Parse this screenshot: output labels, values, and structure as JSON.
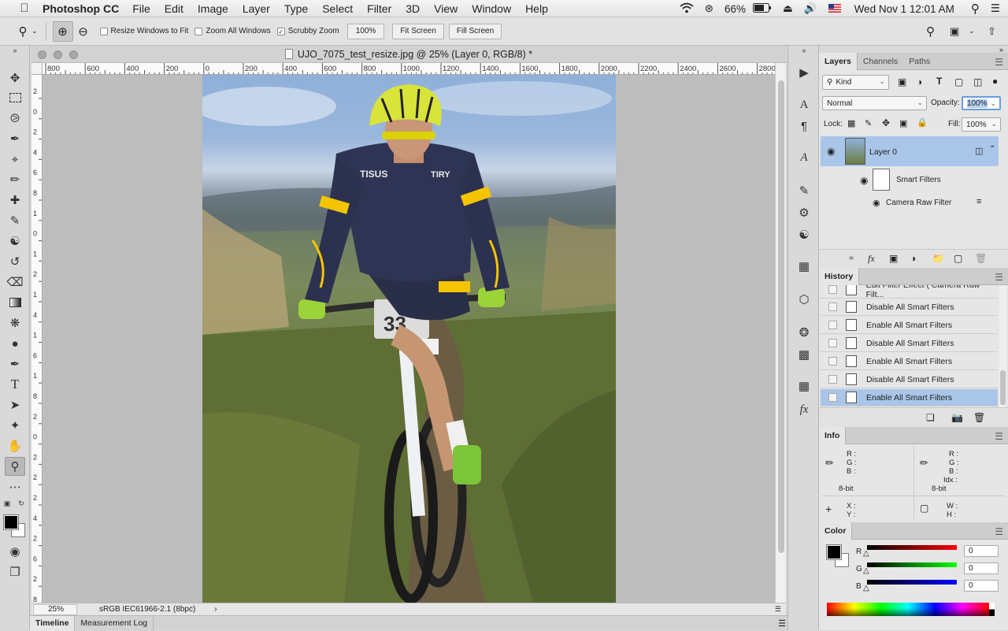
{
  "menubar": {
    "app_name": "Photoshop CC",
    "items": [
      "File",
      "Edit",
      "Image",
      "Layer",
      "Type",
      "Select",
      "Filter",
      "3D",
      "View",
      "Window",
      "Help"
    ],
    "battery": "66%",
    "clock": "Wed Nov 1  12:01 AM"
  },
  "options": {
    "resize_windows": "Resize Windows to Fit",
    "zoom_all": "Zoom All Windows",
    "scrubby": "Scrubby Zoom",
    "zoom_value": "100%",
    "fit_screen": "Fit Screen",
    "fill_screen": "Fill Screen"
  },
  "document": {
    "title": "UJO_7075_test_resize.jpg @ 25% (Layer 0, RGB/8) *",
    "zoom": "25%",
    "profile": "sRGB IEC61966-2.1 (8bpc)",
    "ruler_h": [
      "800",
      "600",
      "400",
      "200",
      "0",
      "200",
      "400",
      "600",
      "800",
      "1000",
      "1200",
      "1400",
      "1600",
      "1800",
      "2000",
      "2200",
      "2400",
      "2600",
      "2800"
    ],
    "ruler_v": [
      "2",
      "0",
      "2",
      "4",
      "6",
      "8",
      "1",
      "0",
      "1",
      "2",
      "1",
      "4",
      "1",
      "6",
      "1",
      "8",
      "2",
      "0",
      "2",
      "2",
      "2",
      "4",
      "2",
      "6",
      "2",
      "8"
    ]
  },
  "bottom_tabs": [
    "Timeline",
    "Measurement Log"
  ],
  "layers_panel": {
    "tabs": [
      "Layers",
      "Channels",
      "Paths"
    ],
    "kind": "Kind",
    "blend_mode": "Normal",
    "opacity_label": "Opacity:",
    "opacity": "100%",
    "lock_label": "Lock:",
    "fill_label": "Fill:",
    "fill": "100%",
    "layer_name": "Layer 0",
    "smart_filters": "Smart Filters",
    "filter_name": "Camera Raw Filter"
  },
  "history_panel": {
    "title": "History",
    "items": [
      "Edit Filter Effect ( Camera Raw Filt...",
      "Disable All Smart Filters",
      "Enable All Smart Filters",
      "Disable All Smart Filters",
      "Enable All Smart Filters",
      "Disable All Smart Filters",
      "Enable All Smart Filters"
    ]
  },
  "info_panel": {
    "title": "Info",
    "r": "R :",
    "g": "G :",
    "b": "B :",
    "idx": "Idx :",
    "bit_left": "8-bit",
    "bit_right": "8-bit",
    "x": "X :",
    "y": "Y :",
    "w": "W :",
    "h": "H :"
  },
  "color_panel": {
    "title": "Color",
    "r_label": "R",
    "g_label": "G",
    "b_label": "B",
    "r": "0",
    "g": "0",
    "b": "0"
  },
  "colors": {
    "accent": "#a9c6e8",
    "foreground": "#000000",
    "background": "#ffffff"
  }
}
